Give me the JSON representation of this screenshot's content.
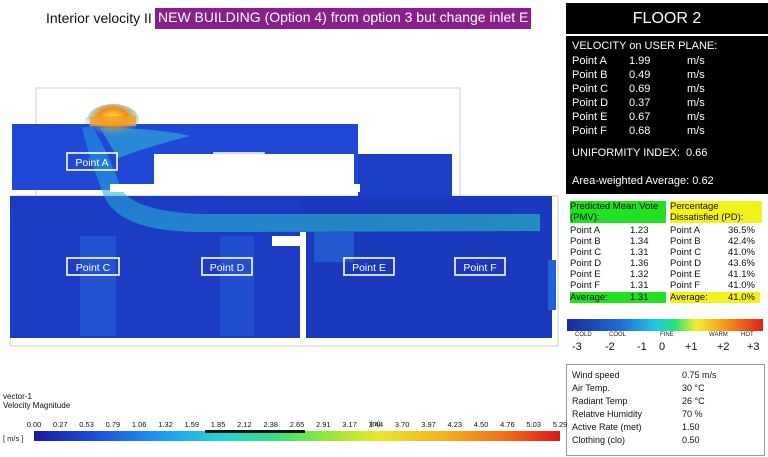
{
  "header": {
    "prefix": "Interior velocity II",
    "highlight": "NEW BUILDING (Option 4) from option 3 but change inlet E",
    "floor": "FLOOR 2"
  },
  "velocity": {
    "heading": "VELOCITY on USER PLANE:",
    "rows": [
      {
        "label": "Point A",
        "value": "1.99",
        "unit": "m/s"
      },
      {
        "label": "Point B",
        "value": "0.49",
        "unit": "m/s"
      },
      {
        "label": "Point C",
        "value": "0.69",
        "unit": "m/s"
      },
      {
        "label": "Point D",
        "value": "0.37",
        "unit": "m/s"
      },
      {
        "label": "Point E",
        "value": "0.67",
        "unit": "m/s"
      },
      {
        "label": "Point F",
        "value": "0.68",
        "unit": "m/s"
      }
    ],
    "uniformity_label": "UNIFORMITY INDEX:",
    "uniformity_value": "0.66",
    "average": "Area-weighted Average: 0.62"
  },
  "pmv": {
    "pmv_title": "Predicted Mean Vote (PMV):",
    "pd_title": "Percentage Dissatisfied (PD):",
    "rows": [
      {
        "p1": "Point A",
        "v1": "1.23",
        "p2": "Point A",
        "v2": "36.5%"
      },
      {
        "p1": "Point B",
        "v1": "1.34",
        "p2": "Point B",
        "v2": "42.4%"
      },
      {
        "p1": "Point C",
        "v1": "1.31",
        "p2": "Point C",
        "v2": "41.0%"
      },
      {
        "p1": "Point D",
        "v1": "1.36",
        "p2": "Point D",
        "v2": "43.6%"
      },
      {
        "p1": "Point E",
        "v1": "1.32",
        "p2": "Point E",
        "v2": "41.1%"
      },
      {
        "p1": "Point F",
        "v1": "1.31",
        "p2": "Point F",
        "v2": "41.0%"
      }
    ],
    "avg_label": "Average:",
    "avg_pmv": "1.31",
    "avg_label2": "Average:",
    "avg_pd": "41.0%"
  },
  "comfort_scale": {
    "words": [
      "COLD",
      "COOL",
      "FINE",
      "WARM",
      "HOT"
    ],
    "numbers": [
      "-3",
      "-2",
      "-1",
      "0",
      "+1",
      "+2",
      "+3"
    ]
  },
  "conditions": [
    {
      "key": "Wind speed",
      "value": "0.75 m/s"
    },
    {
      "key": "Air Temp.",
      "value": "30 °C"
    },
    {
      "key": "Radiant Temp",
      "value": "26 °C"
    },
    {
      "key": "Relative Humidity",
      "value": "70 %"
    },
    {
      "key": "Active Rate (met)",
      "value": "1.50"
    },
    {
      "key": "Clothing (clo)",
      "value": "0.50"
    }
  ],
  "points": {
    "a": "Point A",
    "b": "Point B",
    "c": "Point C",
    "d": "Point D",
    "e": "Point E",
    "f": "Point F"
  },
  "legend": {
    "line1": "vector-1",
    "line2": "Velocity Magnitude",
    "unit": "[ m/s ]",
    "axis_unit": "(m)",
    "ticks": [
      "0.00",
      "0.27",
      "0.53",
      "0.79",
      "1.06",
      "1.32",
      "1.59",
      "1.85",
      "2.12",
      "2.38",
      "2.65",
      "2.91",
      "3.17",
      "3.44",
      "3.70",
      "3.97",
      "4.23",
      "4.50",
      "4.76",
      "5.03",
      "5.29"
    ],
    "inline_label": "0"
  },
  "colors": {
    "highlight_purple": "#8a1e8c",
    "pmv_green": "#22e022",
    "pd_yellow": "#f2f21a",
    "flow_blue": "#1a3fd0"
  }
}
